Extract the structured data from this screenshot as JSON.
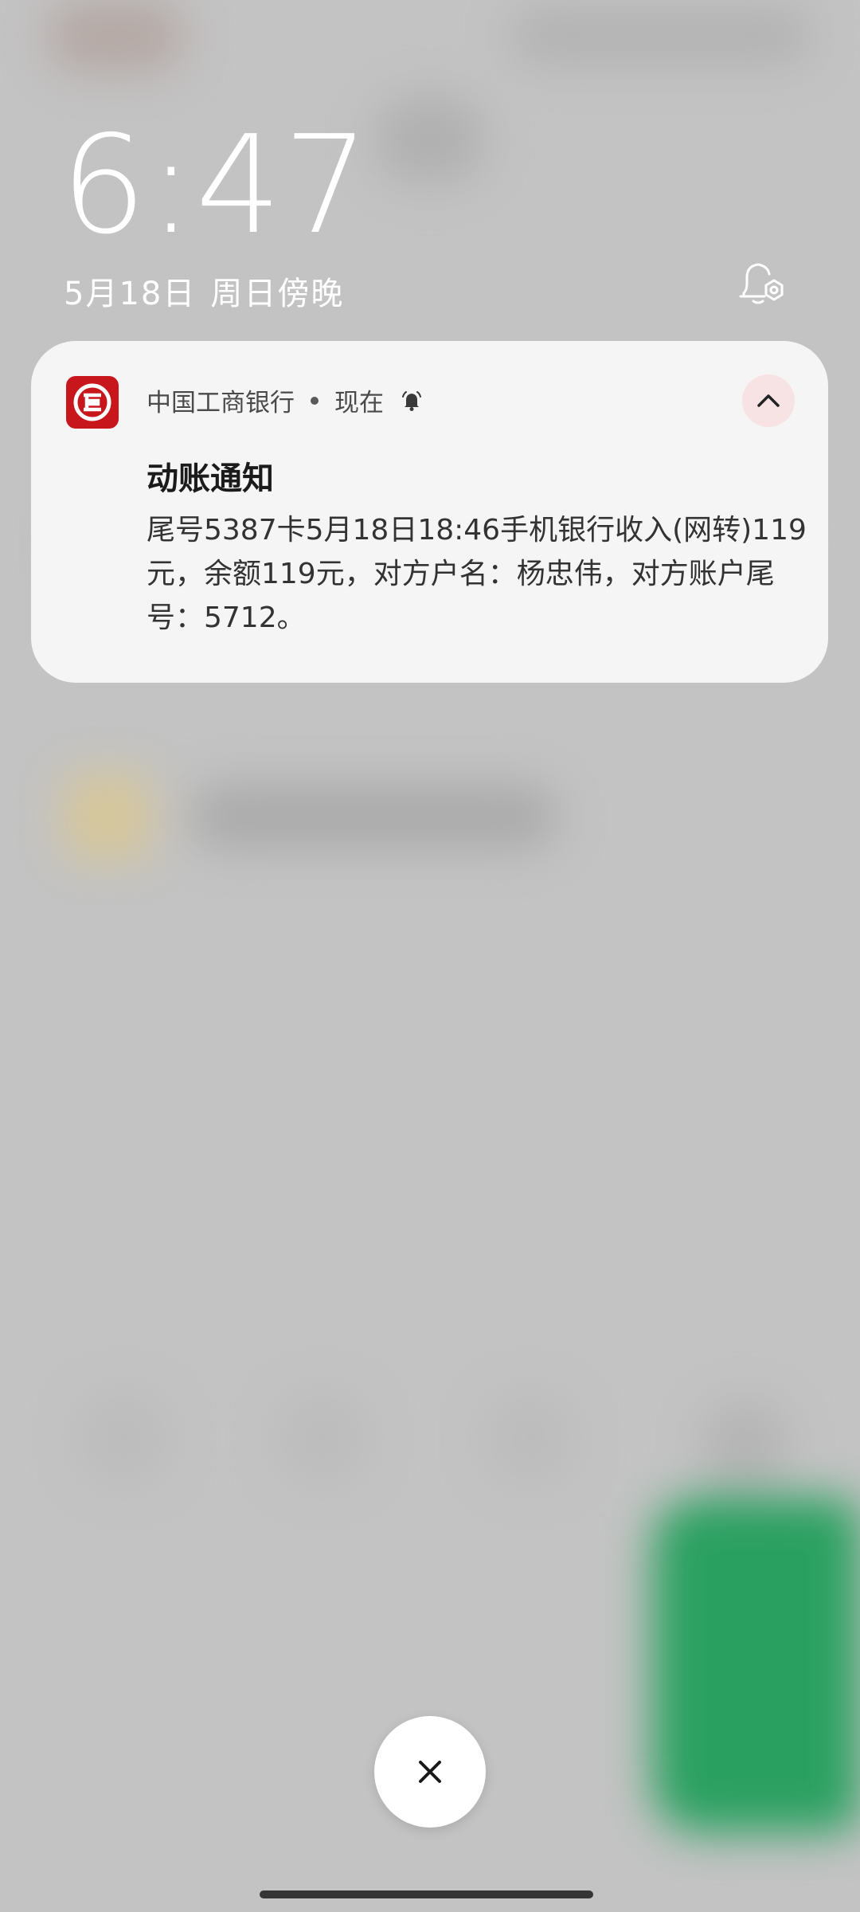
{
  "lockscreen": {
    "time": "6:47",
    "date": "5月18日",
    "weekday_period": "周日傍晚"
  },
  "notification": {
    "app_name": "中国工商银行",
    "time_label": "现在",
    "title": "动账通知",
    "body": "尾号5387卡5月18日18:46手机银行收入(网转)119元，余额119元，对方户名：杨忠伟，对方账户尾号：5712。"
  },
  "colors": {
    "app_icon": "#c8161d",
    "card_bg": "#f6f5f5",
    "collapse_bg": "#f7e3e3"
  },
  "icons": {
    "settings": "notification-settings-icon",
    "app": "icbc-logo-icon",
    "bell": "alerting-bell-icon",
    "collapse": "chevron-up-icon",
    "close": "close-icon"
  }
}
